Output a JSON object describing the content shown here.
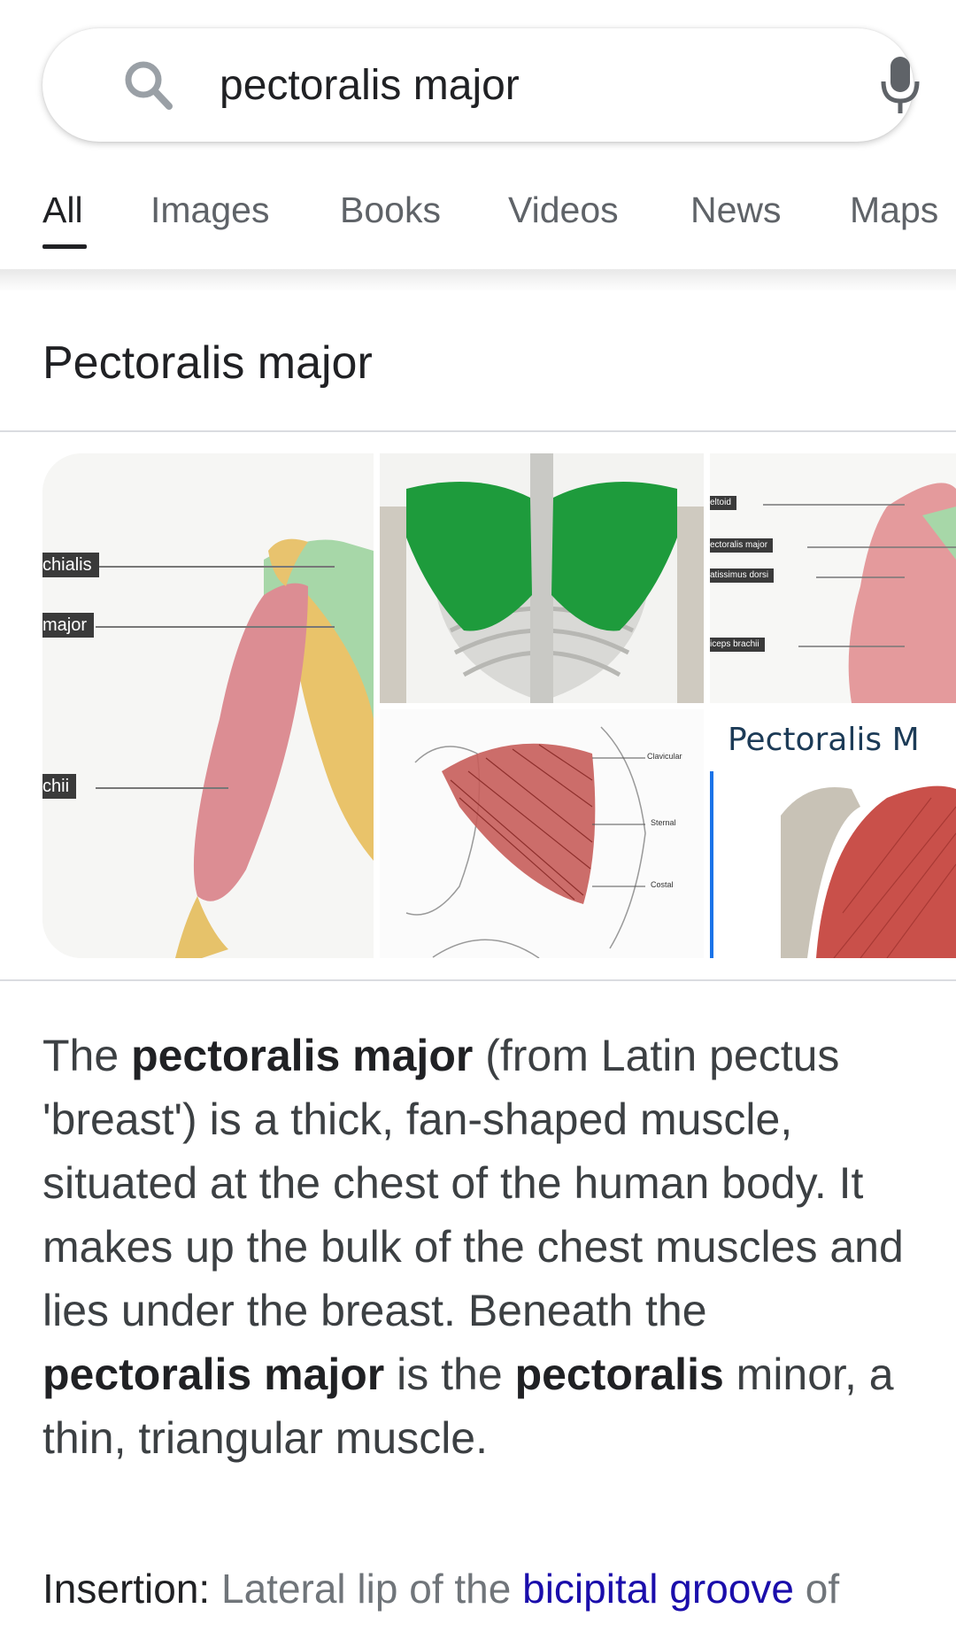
{
  "search": {
    "query": "pectoralis major",
    "search_icon": "search-icon",
    "mic_icon": "mic-icon"
  },
  "tabs": [
    {
      "label": "All",
      "active": true
    },
    {
      "label": "Images"
    },
    {
      "label": "Books"
    },
    {
      "label": "Videos"
    },
    {
      "label": "News"
    },
    {
      "label": "Maps"
    }
  ],
  "panel": {
    "title": "Pectoralis major"
  },
  "images": {
    "tile1_labels": [
      "chialis",
      "major",
      "chii"
    ],
    "tile3_labels": [
      "eltoid",
      "ectoralis major",
      "atissimus dorsi",
      "iceps brachii"
    ],
    "tile4_labels": [
      "Clavicular",
      "Sternal",
      "Costal"
    ],
    "tile5_banner": "Pectoralis M"
  },
  "description": {
    "p1": "The ",
    "b1": "pectoralis major",
    "p2": " (from Latin pectus 'breast') is a thick, fan-shaped muscle, situated at the chest of the human body. It makes up the bulk of the chest muscles and lies under the breast. Beneath the ",
    "b2": "pectoralis major",
    "p3": " is the ",
    "b3": "pectoralis",
    "p4": " minor, a thin, triangular muscle."
  },
  "insertion": {
    "label": "Insertion:",
    "text_before": " Lateral lip of the ",
    "link": "bicipital groove",
    "text_after": " of"
  },
  "colors": {
    "accent_link": "#1a0dab",
    "muscle_green": "#1a9a3a",
    "muscle_red": "#c9504a"
  }
}
